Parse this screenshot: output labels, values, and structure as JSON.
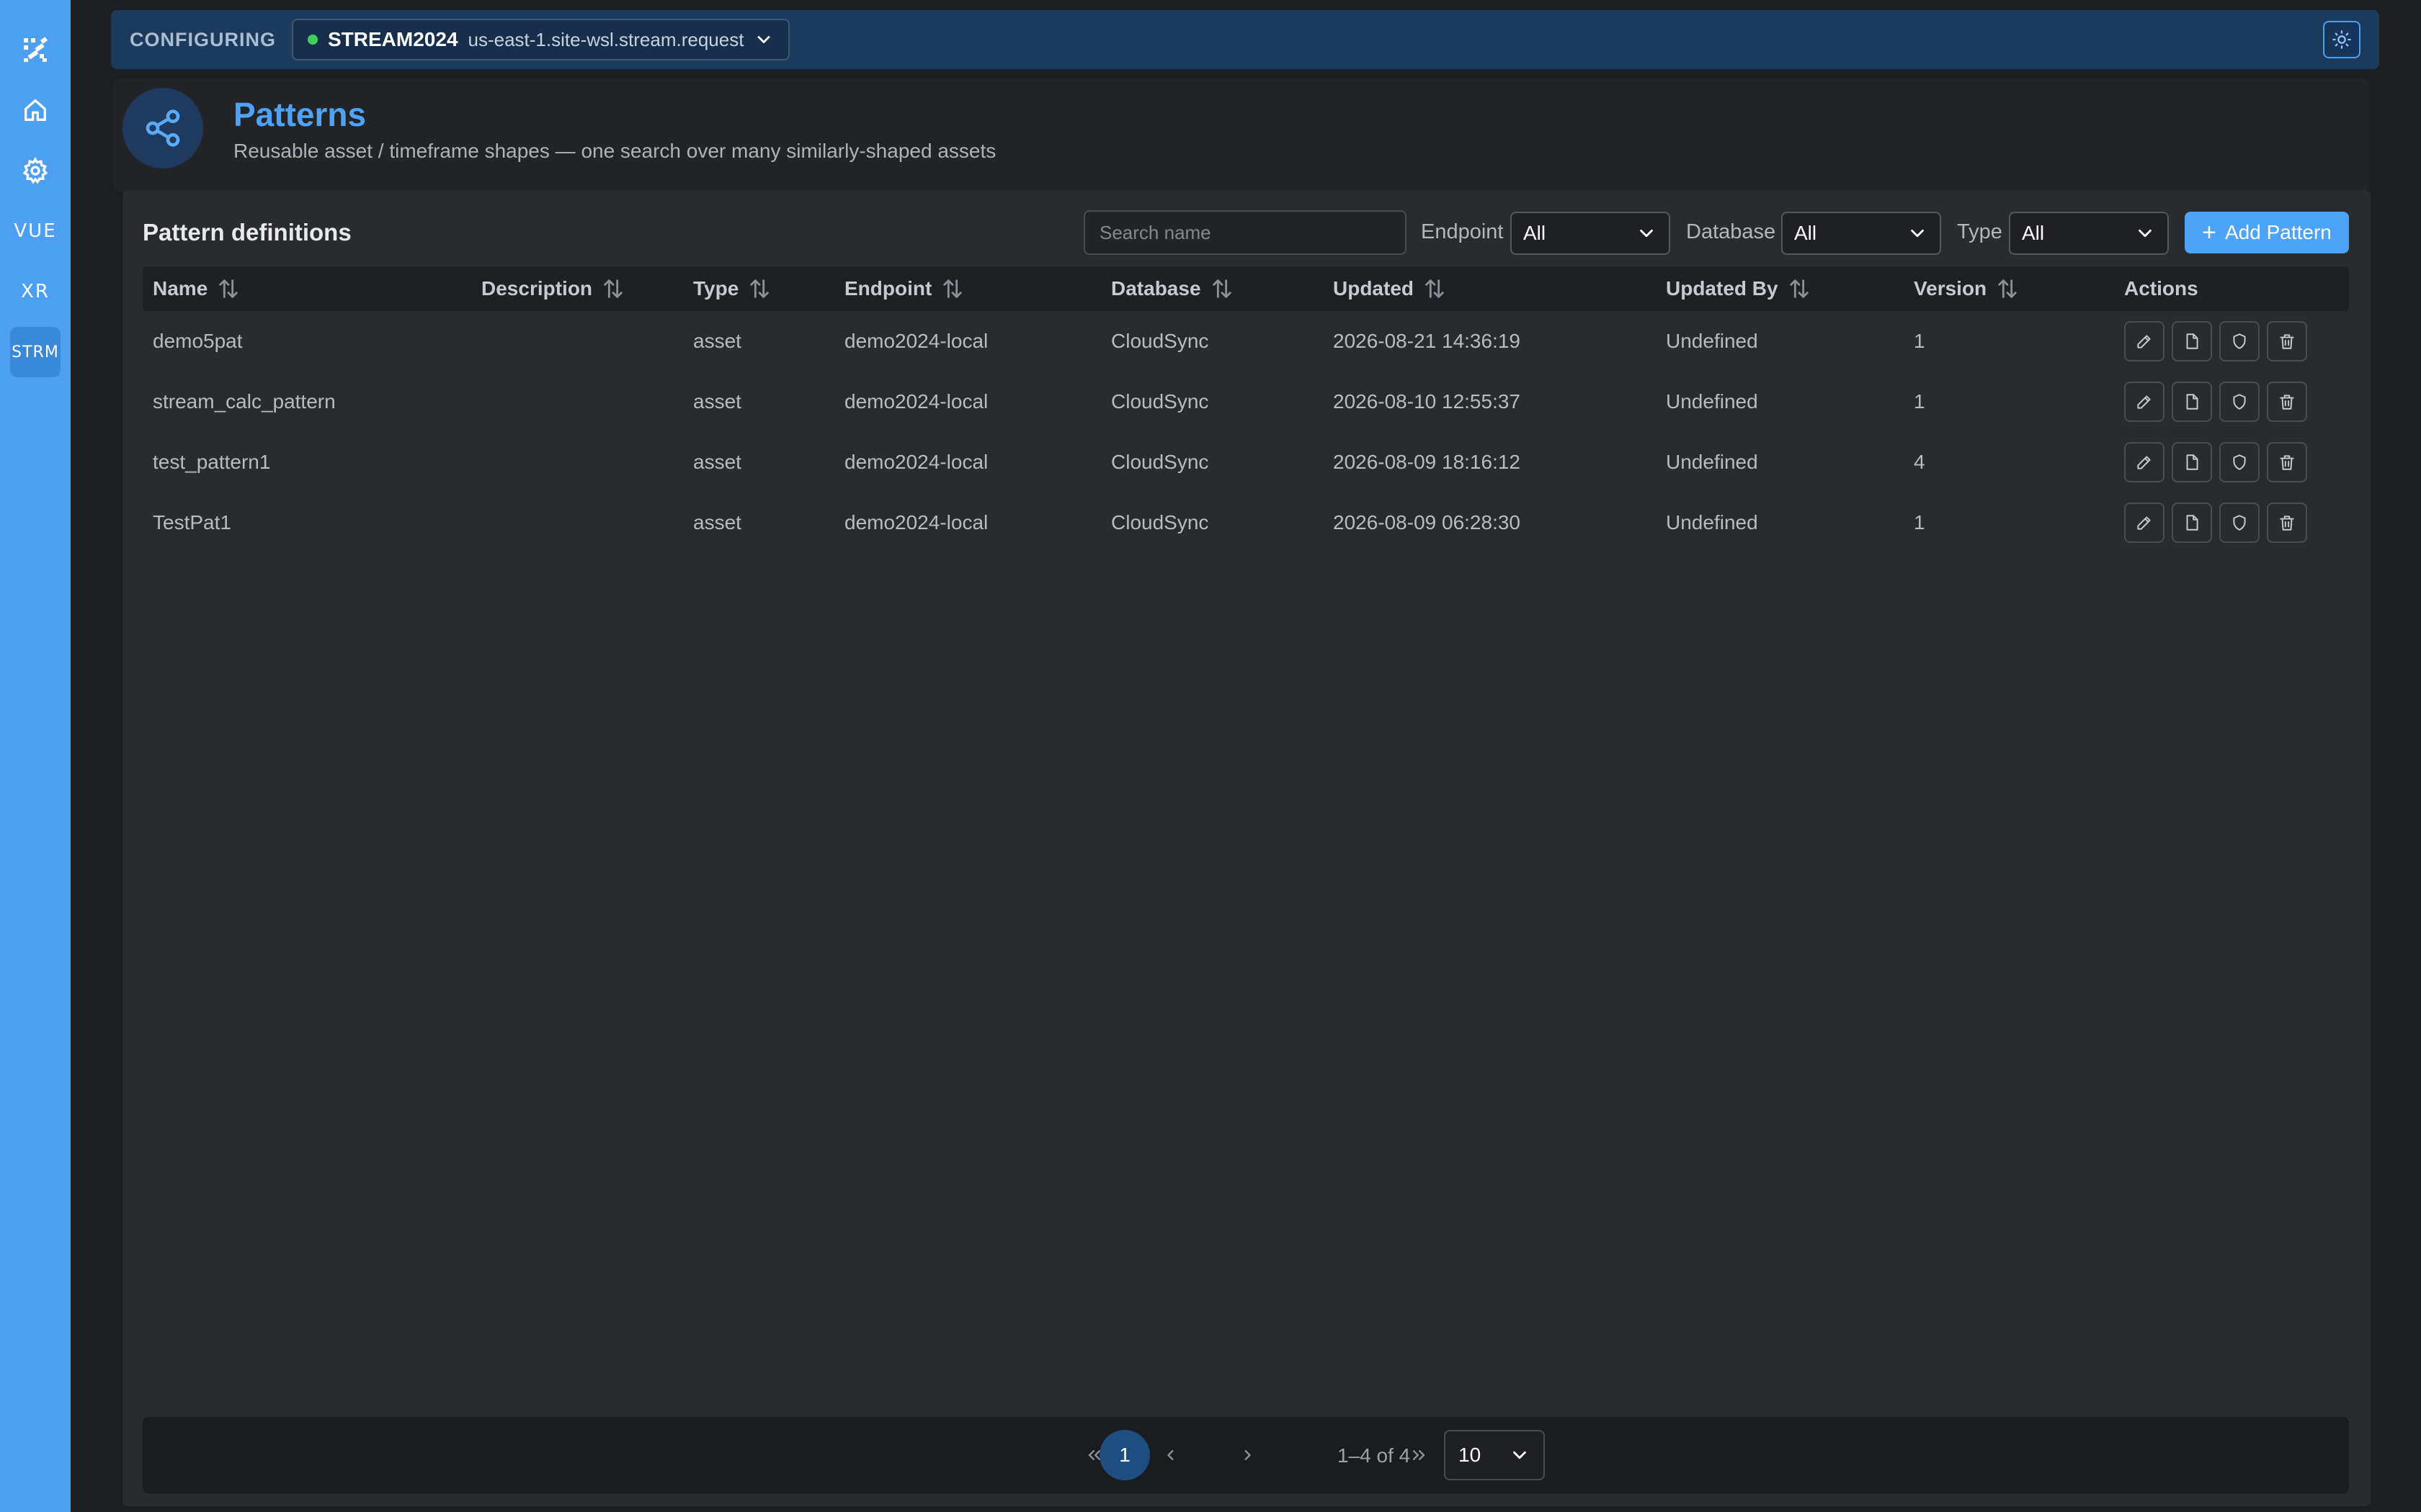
{
  "rail": {
    "items": [
      {
        "name": "logo",
        "icon": "logo-icon"
      },
      {
        "name": "home",
        "icon": "home-icon"
      },
      {
        "name": "settings",
        "icon": "gear-icon"
      },
      {
        "name": "vue",
        "label": "VUE"
      },
      {
        "name": "xr",
        "label": "XR"
      },
      {
        "name": "strm",
        "label": "STRM",
        "active": true
      }
    ]
  },
  "topbar": {
    "configuring_label": "CONFIGURING",
    "env_name": "STREAM2024",
    "env_host": "us-east-1.site-wsl.stream.request",
    "status_color": "#3fcf5c",
    "theme_icon": "sun-icon"
  },
  "header": {
    "title": "Patterns",
    "subtitle": "Reusable asset / timeframe shapes — one search over many similarly-shaped assets",
    "icon": "share-icon"
  },
  "card": {
    "title": "Pattern definitions",
    "search_placeholder": "Search name",
    "filters": {
      "endpoint_label": "Endpoint",
      "endpoint_value": "All",
      "database_label": "Database",
      "database_value": "All",
      "type_label": "Type",
      "type_value": "All"
    },
    "add_button_label": "Add Pattern"
  },
  "table": {
    "columns": [
      "Name",
      "Description",
      "Type",
      "Endpoint",
      "Database",
      "Updated",
      "Updated By",
      "Version",
      "Actions"
    ],
    "rows": [
      {
        "name": "demo5pat",
        "description": "",
        "type": "asset",
        "endpoint": "demo2024-local",
        "database": "CloudSync",
        "updated": "2026-08-21 14:36:19",
        "updated_by": "Undefined",
        "version": "1"
      },
      {
        "name": "stream_calc_pattern",
        "description": "",
        "type": "asset",
        "endpoint": "demo2024-local",
        "database": "CloudSync",
        "updated": "2026-08-10 12:55:37",
        "updated_by": "Undefined",
        "version": "1"
      },
      {
        "name": "test_pattern1",
        "description": "",
        "type": "asset",
        "endpoint": "demo2024-local",
        "database": "CloudSync",
        "updated": "2026-08-09 18:16:12",
        "updated_by": "Undefined",
        "version": "4"
      },
      {
        "name": "TestPat1",
        "description": "",
        "type": "asset",
        "endpoint": "demo2024-local",
        "database": "CloudSync",
        "updated": "2026-08-09 06:28:30",
        "updated_by": "Undefined",
        "version": "1"
      }
    ]
  },
  "pagination": {
    "current_page": "1",
    "range": "1–4 of 4",
    "page_size": "10"
  },
  "colors": {
    "accent": "#4da3f7",
    "rail": "#4d9ff2",
    "topbar": "#1c3a5c"
  }
}
